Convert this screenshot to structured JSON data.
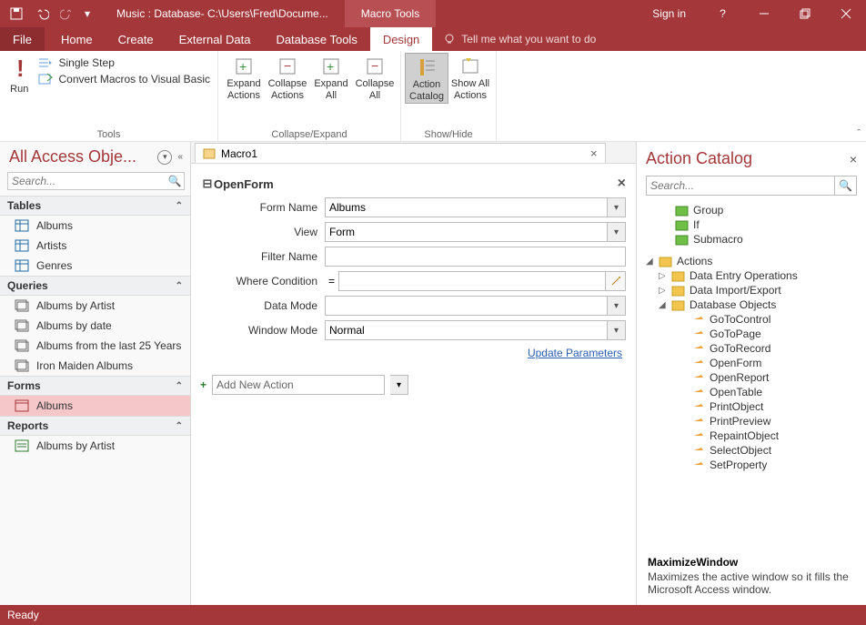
{
  "titlebar": {
    "title": "Music : Database- C:\\Users\\Fred\\Docume...",
    "context_tab": "Macro Tools",
    "signin": "Sign in"
  },
  "ribbon_tabs": {
    "file": "File",
    "home": "Home",
    "create": "Create",
    "external": "External Data",
    "dbtools": "Database Tools",
    "design": "Design",
    "tellme": "Tell me what you want to do"
  },
  "ribbon": {
    "run": "Run",
    "single_step": "Single Step",
    "convert": "Convert Macros to Visual Basic",
    "tools_label": "Tools",
    "expand_actions": "Expand\nActions",
    "collapse_actions": "Collapse\nActions",
    "expand_all": "Expand\nAll",
    "collapse_all": "Collapse\nAll",
    "collapse_expand_label": "Collapse/Expand",
    "action_catalog": "Action\nCatalog",
    "show_all": "Show All\nActions",
    "show_hide_label": "Show/Hide"
  },
  "nav": {
    "header": "All Access Obje...",
    "search_placeholder": "Search...",
    "groups": {
      "tables": {
        "label": "Tables",
        "items": [
          "Albums",
          "Artists",
          "Genres"
        ]
      },
      "queries": {
        "label": "Queries",
        "items": [
          "Albums by Artist",
          "Albums by date",
          "Albums from the last 25 Years",
          "Iron Maiden Albums"
        ]
      },
      "forms": {
        "label": "Forms",
        "items": [
          "Albums"
        ]
      },
      "reports": {
        "label": "Reports",
        "items": [
          "Albums by Artist"
        ]
      }
    }
  },
  "doc": {
    "tab_name": "Macro1",
    "action": {
      "name": "OpenForm",
      "params": {
        "form_name_label": "Form Name",
        "form_name_value": "Albums",
        "view_label": "View",
        "view_value": "Form",
        "filter_label": "Filter Name",
        "filter_value": "",
        "where_label": "Where Condition",
        "where_value": "=",
        "data_mode_label": "Data Mode",
        "data_mode_value": "",
        "window_mode_label": "Window Mode",
        "window_mode_value": "Normal"
      },
      "update_link": "Update Parameters"
    },
    "add_new": "Add New Action"
  },
  "catalog": {
    "title": "Action Catalog",
    "search_placeholder": "Search...",
    "flow": [
      "Group",
      "If",
      "Submacro"
    ],
    "actions_root": "Actions",
    "cats": {
      "data_entry": "Data Entry Operations",
      "data_import": "Data Import/Export",
      "db_objects": "Database Objects"
    },
    "db_children": [
      "GoToControl",
      "GoToPage",
      "GoToRecord",
      "OpenForm",
      "OpenReport",
      "OpenTable",
      "PrintObject",
      "PrintPreview",
      "RepaintObject",
      "SelectObject",
      "SetProperty"
    ],
    "detail": {
      "name": "MaximizeWindow",
      "desc": "Maximizes the active window so it fills the Microsoft Access window."
    }
  },
  "status": {
    "ready": "Ready"
  }
}
